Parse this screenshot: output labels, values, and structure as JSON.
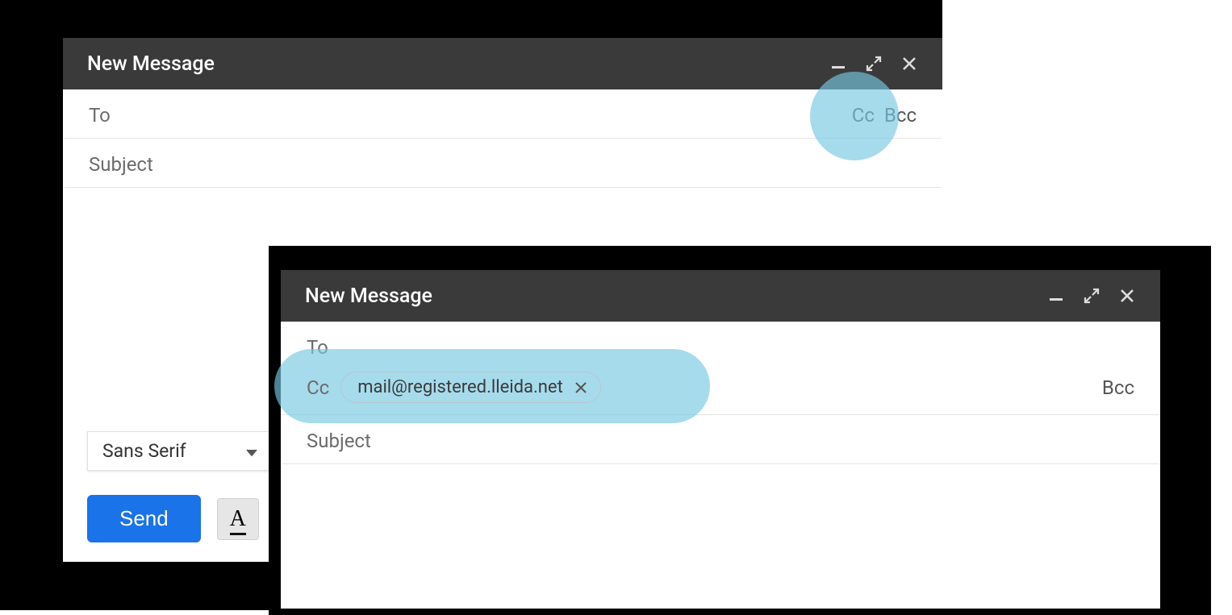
{
  "compose1": {
    "title": "New Message",
    "to_label": "To",
    "cc_action": "Cc",
    "bcc_action": "Bcc",
    "subject_label": "Subject",
    "font": "Sans Serif",
    "send": "Send"
  },
  "compose2": {
    "title": "New Message",
    "to_label": "To",
    "cc_label": "Cc",
    "cc_chip": "mail@registered.lleida.net",
    "bcc_action": "Bcc",
    "subject_label": "Subject"
  }
}
